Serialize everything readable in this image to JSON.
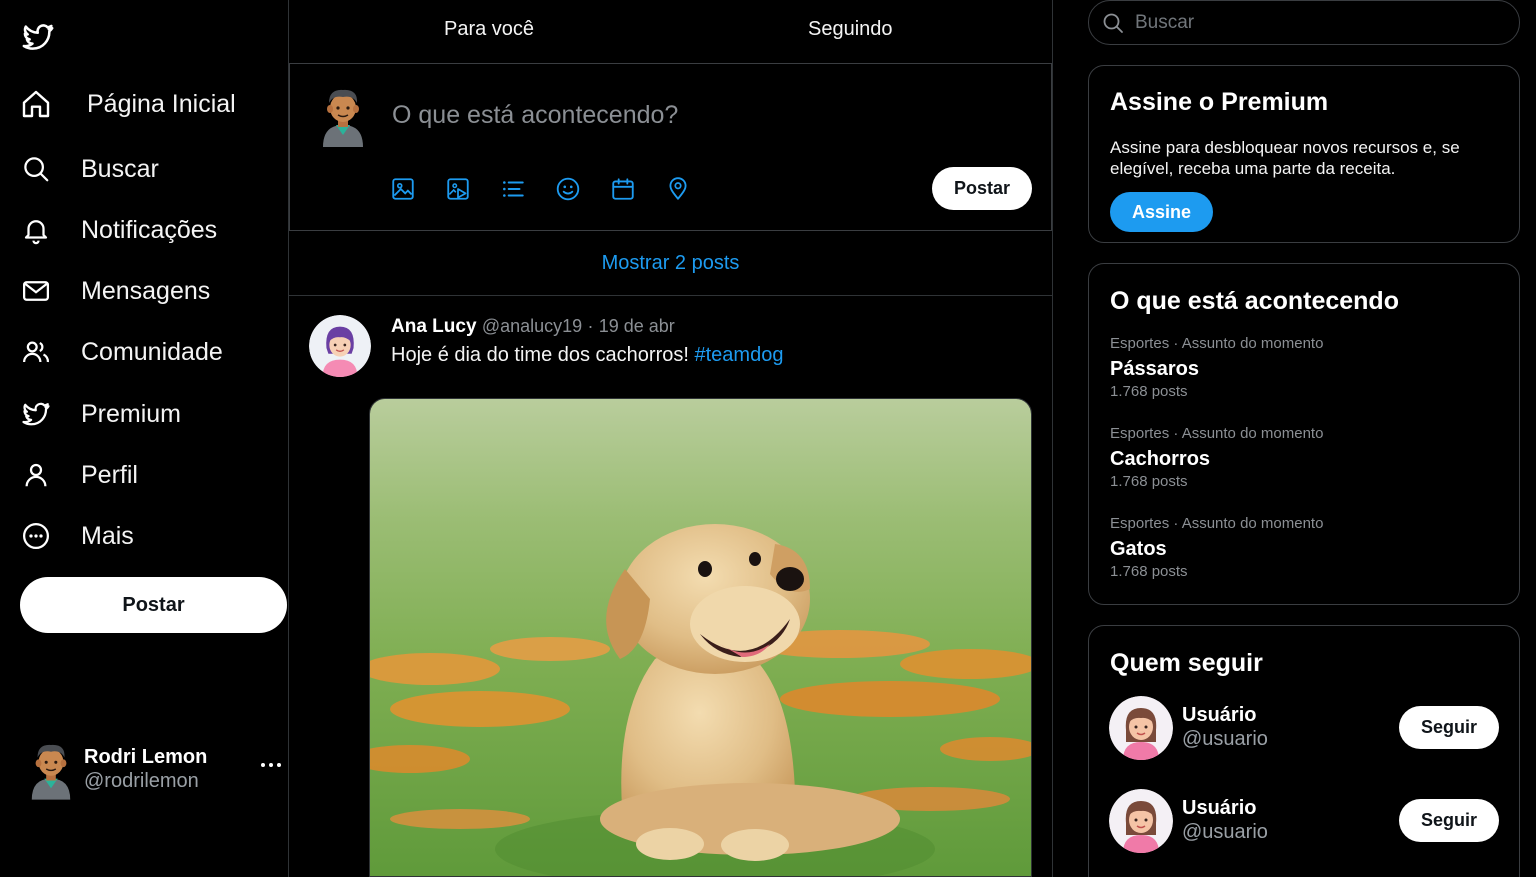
{
  "app": {
    "logo_icon": "bird-logo-icon",
    "accent": "#1d9bf0"
  },
  "nav": {
    "items": [
      {
        "label": "Página Inicial",
        "icon": "home-icon"
      },
      {
        "label": "Buscar",
        "icon": "search-icon"
      },
      {
        "label": "Notificações",
        "icon": "bell-icon"
      },
      {
        "label": "Mensagens",
        "icon": "mail-icon"
      },
      {
        "label": "Comunidade",
        "icon": "users-icon"
      },
      {
        "label": "Premium",
        "icon": "bird-icon"
      },
      {
        "label": "Perfil",
        "icon": "user-icon"
      },
      {
        "label": "Mais",
        "icon": "more-circle-icon"
      }
    ],
    "post_button": "Postar"
  },
  "account": {
    "name": "Rodri Lemon",
    "handle": "@rodrilemon"
  },
  "feed": {
    "tabs": [
      {
        "label": "Para você"
      },
      {
        "label": "Seguindo"
      }
    ],
    "composer": {
      "placeholder": "O que está acontecendo?",
      "tools": [
        "image-icon",
        "gif-icon",
        "poll-icon",
        "emoji-icon",
        "schedule-icon",
        "location-icon"
      ],
      "post_button": "Postar"
    },
    "show_posts": "Mostrar 2 posts",
    "tweet": {
      "author": "Ana Lucy",
      "handle": "@analucy19",
      "separator": "·",
      "date": "19 de abr",
      "text": "Hoje é dia do time dos cachorros! ",
      "hashtag": "#teamdog",
      "media": "puppy-photo"
    }
  },
  "search": {
    "placeholder": "Buscar"
  },
  "premium": {
    "title": "Assine o Premium",
    "description": "Assine para desbloquear novos recursos e, se elegível, receba uma parte da receita.",
    "button": "Assine"
  },
  "trends": {
    "title": "O que está acontecendo",
    "items": [
      {
        "meta": "Esportes · Assunto do momento",
        "name": "Pássaros",
        "count": "1.768 posts"
      },
      {
        "meta": "Esportes · Assunto do momento",
        "name": "Cachorros",
        "count": "1.768 posts"
      },
      {
        "meta": "Esportes · Assunto do momento",
        "name": "Gatos",
        "count": "1.768 posts"
      }
    ]
  },
  "who_to_follow": {
    "title": "Quem seguir",
    "users": [
      {
        "name": "Usuário",
        "handle": "@usuario",
        "button": "Seguir"
      },
      {
        "name": "Usuário",
        "handle": "@usuario",
        "button": "Seguir"
      }
    ]
  }
}
